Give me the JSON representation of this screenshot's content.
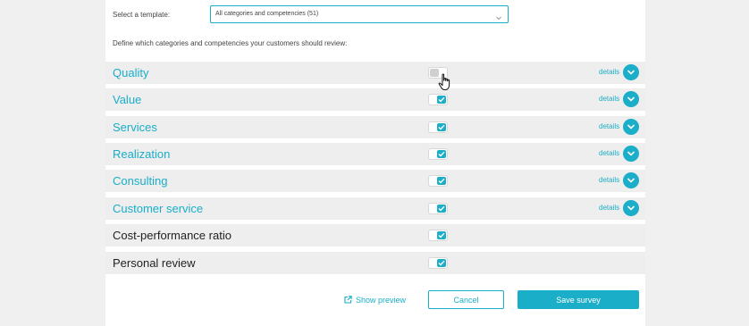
{
  "template": {
    "label": "Select a template:",
    "selected": "All categories and competencies (51)"
  },
  "instruction": "Define which categories and competencies your customers should review:",
  "categories": [
    {
      "name": "Quality",
      "enabled": false,
      "details_label": "details",
      "has_details": true
    },
    {
      "name": "Value",
      "enabled": true,
      "details_label": "details",
      "has_details": true
    },
    {
      "name": "Services",
      "enabled": true,
      "details_label": "details",
      "has_details": true
    },
    {
      "name": "Realization",
      "enabled": true,
      "details_label": "details",
      "has_details": true
    },
    {
      "name": "Consulting",
      "enabled": true,
      "details_label": "details",
      "has_details": true
    },
    {
      "name": "Customer service",
      "enabled": true,
      "details_label": "details",
      "has_details": true
    },
    {
      "name": "Cost-performance ratio",
      "enabled": true,
      "has_details": false
    },
    {
      "name": "Personal review",
      "enabled": true,
      "has_details": false
    }
  ],
  "footer": {
    "preview_label": "Show preview",
    "cancel_label": "Cancel",
    "save_label": "Save survey"
  },
  "colors": {
    "accent": "#1aaec8",
    "row_background": "#eeeeee",
    "page_background": "#f0f0f0"
  }
}
